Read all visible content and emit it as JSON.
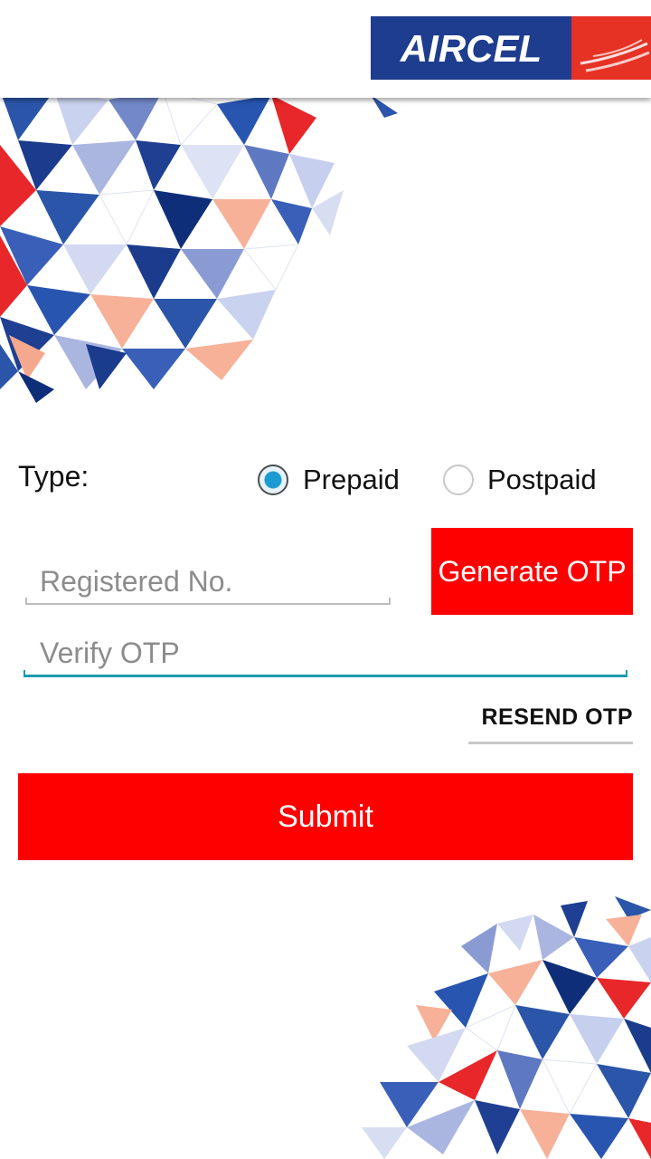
{
  "header": {
    "logo_text": "AIRCEL",
    "brand_blue": "#1f3d8f",
    "brand_red": "#e53225"
  },
  "form": {
    "type_label": "Type:",
    "radio_options": [
      {
        "label": "Prepaid",
        "selected": true
      },
      {
        "label": "Postpaid",
        "selected": false
      }
    ],
    "registered_no": {
      "placeholder": "Registered No.",
      "value": ""
    },
    "verify_otp": {
      "placeholder": "Verify OTP",
      "value": ""
    },
    "generate_otp_label": "Generate OTP",
    "resend_otp_label": "RESEND OTP",
    "submit_label": "Submit"
  },
  "colors": {
    "accent_red": "#ff0000",
    "focus_teal": "#1c9bb2",
    "radio_blue": "#1b9bd1"
  },
  "icons": {
    "decor": "triangle-mosaic-pattern"
  }
}
